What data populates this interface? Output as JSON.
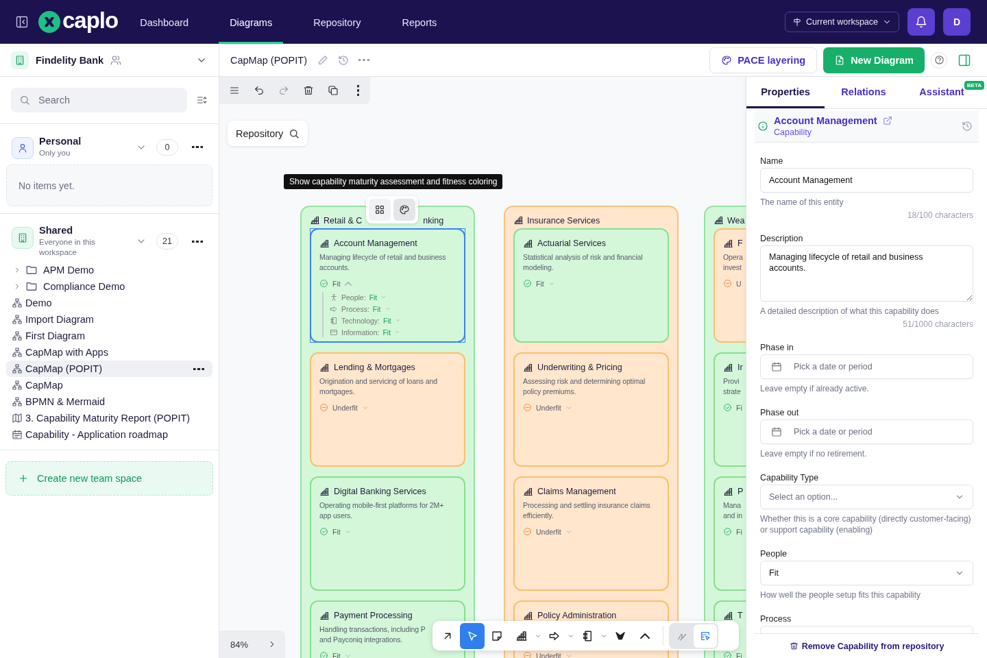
{
  "topbar": {
    "logo": "caplo",
    "nav": [
      {
        "label": "Dashboard",
        "selected": false
      },
      {
        "label": "Diagrams",
        "selected": true
      },
      {
        "label": "Repository",
        "selected": false
      },
      {
        "label": "Reports",
        "selected": false
      }
    ],
    "workspace_button": "Current workspace",
    "avatar": "D"
  },
  "sidebar": {
    "workspace": "Findelity Bank",
    "search": {
      "placeholder": "Search"
    },
    "sections": [
      {
        "kind": "personal",
        "title": "Personal",
        "subtitle": "Only you",
        "count": "0",
        "empty": "No items yet."
      },
      {
        "kind": "shared",
        "title": "Shared",
        "subtitle": "Everyone in this workspace",
        "count": "21",
        "items": [
          {
            "kind": "folder",
            "label": "APM Demo",
            "selected": false
          },
          {
            "kind": "folder",
            "label": "Compliance Demo",
            "selected": false
          },
          {
            "kind": "diagram",
            "label": "Demo",
            "selected": false
          },
          {
            "kind": "diagram",
            "label": "Import Diagram",
            "selected": false
          },
          {
            "kind": "diagram",
            "label": "First Diagram",
            "selected": false
          },
          {
            "kind": "diagram",
            "label": "CapMap with Apps",
            "selected": false
          },
          {
            "kind": "diagram",
            "label": "CapMap (POPIT)",
            "selected": true
          },
          {
            "kind": "diagram",
            "label": "CapMap",
            "selected": false
          },
          {
            "kind": "diagram",
            "label": "BPMN & Mermaid",
            "selected": false
          },
          {
            "kind": "map",
            "label": "3. Capability Maturity Report (POPIT)",
            "selected": false
          },
          {
            "kind": "roadmap",
            "label": "Capability - Application roadmap",
            "selected": false
          }
        ]
      }
    ],
    "create_button": "Create new team space"
  },
  "document": {
    "title": "CapMap (POPIT)",
    "buttons": [
      {
        "kind": "outline",
        "label": "PACE layering"
      },
      {
        "kind": "primary",
        "label": "New Diagram"
      }
    ]
  },
  "canvas": {
    "repository_button": "Repository",
    "tooltip": "Show capability maturity assessment and fitness coloring",
    "zoom": "84%",
    "view_toggle": [
      {
        "kind": "grid",
        "selected": false
      },
      {
        "kind": "palette",
        "selected": true
      }
    ],
    "columns": [
      {
        "title_parts": [
          "Retail & C",
          "nking"
        ],
        "kind": "fit",
        "cards": [
          {
            "title": "Account Management",
            "desc_lines": [
              "Managing lifecycle of retail and business",
              "accounts."
            ],
            "kind": "fit",
            "status": "Fit",
            "expanded": true,
            "selected": true,
            "details": [
              {
                "kind": "people",
                "label": "People:",
                "value": "Fit"
              },
              {
                "kind": "process",
                "label": "Process:",
                "value": "Fit"
              },
              {
                "kind": "technology",
                "label": "Technology:",
                "value": "Fit"
              },
              {
                "kind": "information",
                "label": "Information:",
                "value": "Fit"
              }
            ]
          },
          {
            "title": "Lending & Mortgages",
            "desc_lines": [
              "Origination and servicing of loans and",
              "mortgages."
            ],
            "kind": "underfit",
            "status": "Underfit",
            "expanded": false,
            "selected": false
          },
          {
            "title": "Digital Banking Services",
            "desc_lines": [
              "Operating mobile-first platforms for 2M+",
              "app users."
            ],
            "kind": "fit",
            "status": "Fit",
            "expanded": false,
            "selected": false
          },
          {
            "title": "Payment Processing",
            "desc_lines": [
              "Handling transactions, including P",
              "and Payconiq integrations."
            ],
            "kind": "fit",
            "status": "Fit",
            "expanded": false,
            "selected": false
          }
        ]
      },
      {
        "title_parts": [
          "Insurance Services"
        ],
        "kind": "underfit",
        "cards": [
          {
            "title": "Actuarial Services",
            "desc_lines": [
              "Statistical analysis of risk and financial",
              "modeling."
            ],
            "kind": "fit",
            "status": "Fit",
            "expanded": false,
            "selected": false
          },
          {
            "title": "Underwriting & Pricing",
            "desc_lines": [
              "Assessing risk and determining optimal",
              "policy premiums."
            ],
            "kind": "underfit",
            "status": "Underfit",
            "expanded": false,
            "selected": false
          },
          {
            "title": "Claims Management",
            "desc_lines": [
              "Processing and settling insurance claims",
              "efficiently."
            ],
            "kind": "underfit",
            "status": "Underfit",
            "expanded": false,
            "selected": false
          },
          {
            "title": "Policy Administration",
            "kind": "underfit",
            "status": "Underfit",
            "expanded": false,
            "selected": false
          }
        ]
      },
      {
        "title_parts": [
          "Wea"
        ],
        "kind": "fit",
        "cards": [
          {
            "title": "F",
            "desc_lines": [
              "Opera",
              "invest"
            ],
            "kind": "underfit",
            "status": "U"
          },
          {
            "title": "Ir",
            "desc_lines": [
              "Provi",
              "strate"
            ],
            "kind": "fit",
            "status": "Fi"
          },
          {
            "title": "P",
            "desc_lines": [
              "Mana",
              "and in"
            ],
            "kind": "fit",
            "status": "Fi"
          },
          {
            "title": "T",
            "kind": "fit",
            "status": "Fi"
          }
        ]
      }
    ],
    "tools": [
      {
        "kind": "connector",
        "selected": false
      },
      {
        "kind": "pointer",
        "selected": true
      },
      {
        "kind": "note",
        "selected": false
      },
      {
        "kind": "capability",
        "selected": false,
        "menu": true
      },
      {
        "kind": "process",
        "selected": false,
        "menu": true
      },
      {
        "kind": "component",
        "selected": false,
        "menu": true
      },
      {
        "kind": "logo",
        "selected": false
      },
      {
        "kind": "more",
        "selected": false
      }
    ],
    "draw_modes": [
      {
        "kind": "pen",
        "selected": false
      },
      {
        "kind": "select",
        "selected": true
      }
    ]
  },
  "panel": {
    "tabs": [
      {
        "label": "Properties",
        "selected": true
      },
      {
        "label": "Relations",
        "selected": false
      },
      {
        "label": "Assistant",
        "selected": false,
        "badge": "BETA"
      }
    ],
    "entity": {
      "name": "Account Management",
      "type": "Capability"
    },
    "fields": [
      {
        "kind": "text",
        "label": "Name",
        "value": "Account Management",
        "hint": "The name of this entity",
        "counter": "18/100 characters"
      },
      {
        "kind": "textarea",
        "label": "Description",
        "value": "Managing lifecycle of retail and business accounts.",
        "hint": "A detailed description of what this capability does",
        "counter": "51/1000 characters"
      },
      {
        "kind": "date",
        "label": "Phase in",
        "placeholder": "Pick a date or period",
        "hint": "Leave empty if already active."
      },
      {
        "kind": "date",
        "label": "Phase out",
        "placeholder": "Pick a date or period",
        "hint": "Leave empty if no retirement."
      },
      {
        "kind": "select",
        "label": "Capability Type",
        "placeholder": "Select an option...",
        "hint": "Whether this is a core capability (directly customer-facing) or support capability (enabling)"
      },
      {
        "kind": "select",
        "label": "People",
        "value": "Fit",
        "hint": "How well the people setup fits this capability"
      },
      {
        "kind": "select",
        "label": "Process"
      }
    ],
    "remove_button": "Remove Capability from repository"
  }
}
